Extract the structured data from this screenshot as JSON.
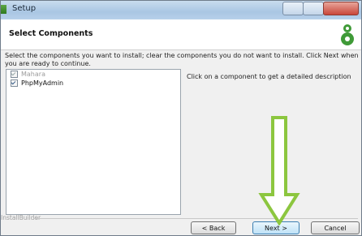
{
  "window": {
    "title": "Setup"
  },
  "header": {
    "title": "Select Components"
  },
  "instruction": "Select the components you want to install; clear the components you do not want to install. Click Next when you are ready to continue.",
  "components": [
    {
      "label": "Mahara",
      "checked": true,
      "disabled": true
    },
    {
      "label": "PhpMyAdmin",
      "checked": true,
      "disabled": false
    }
  ],
  "description": "Click on a component to get a detailed description",
  "footer": {
    "brand": "InstallBuilder"
  },
  "buttons": {
    "back": "< Back",
    "next": "Next >",
    "cancel": "Cancel"
  },
  "colors": {
    "annotation_arrow": "#8cc63f",
    "logo_green": "#3f9a37"
  }
}
